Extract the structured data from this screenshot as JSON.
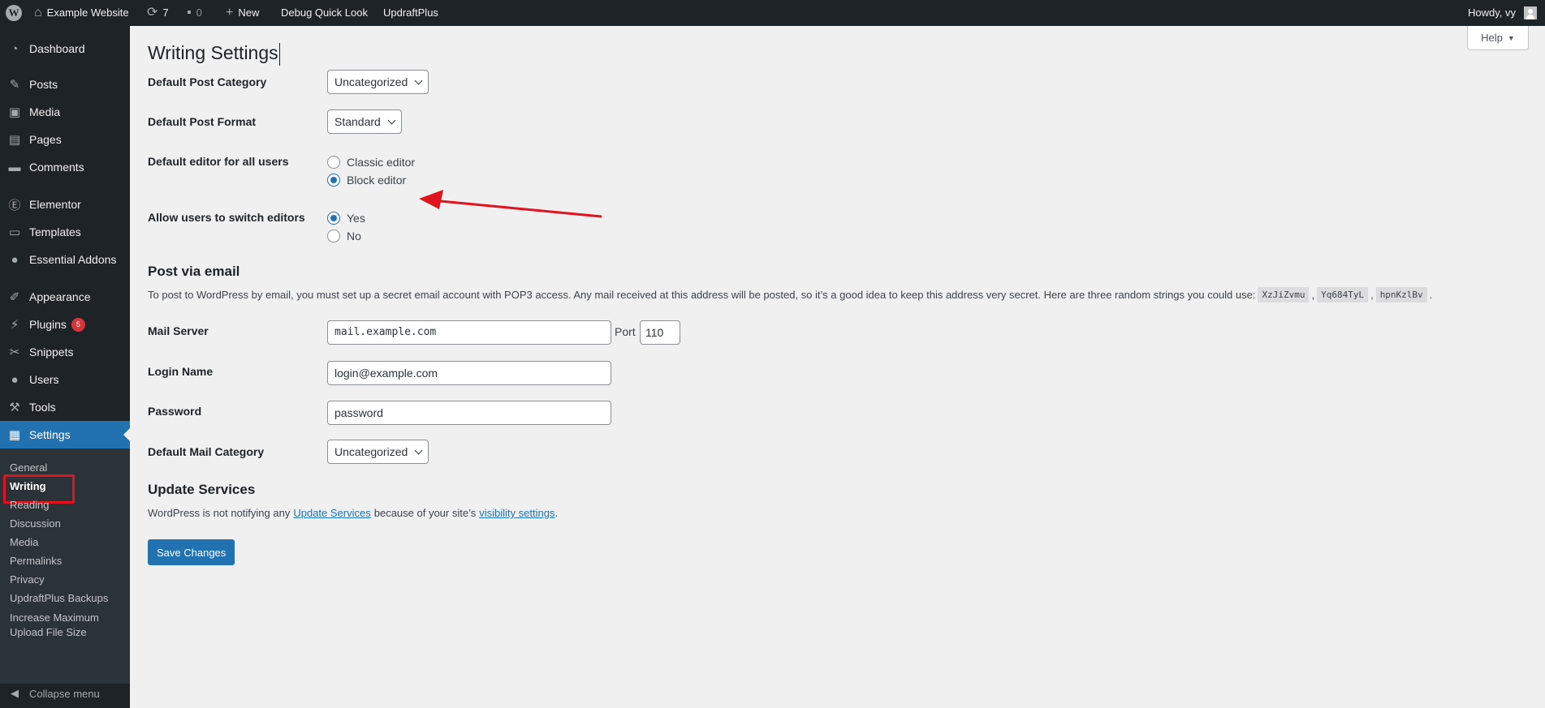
{
  "admin_bar": {
    "site_name": "Example Website",
    "updates_count": "7",
    "comments_count": "0",
    "new_label": "New",
    "debug_label": "Debug Quick Look",
    "updraft_label": "UpdraftPlus",
    "howdy": "Howdy, vy"
  },
  "sidebar": {
    "items": [
      {
        "label": "Dashboard",
        "icon": "dashboard-icon"
      },
      {
        "label": "Posts",
        "icon": "pin-icon"
      },
      {
        "label": "Media",
        "icon": "media-icon"
      },
      {
        "label": "Pages",
        "icon": "pages-icon"
      },
      {
        "label": "Comments",
        "icon": "comment-icon"
      },
      {
        "label": "Elementor",
        "icon": "elementor-icon"
      },
      {
        "label": "Templates",
        "icon": "folder-icon"
      },
      {
        "label": "Essential Addons",
        "icon": "ea-icon"
      },
      {
        "label": "Appearance",
        "icon": "brush-icon"
      },
      {
        "label": "Plugins",
        "icon": "plug-icon",
        "badge": "5"
      },
      {
        "label": "Snippets",
        "icon": "scissors-icon"
      },
      {
        "label": "Users",
        "icon": "user-icon"
      },
      {
        "label": "Tools",
        "icon": "wrench-icon"
      },
      {
        "label": "Settings",
        "icon": "settings-icon"
      }
    ],
    "submenu": [
      "General",
      "Writing",
      "Reading",
      "Discussion",
      "Media",
      "Permalinks",
      "Privacy",
      "UpdraftPlus Backups",
      "Increase Maximum",
      "Upload File Size"
    ],
    "collapse_label": "Collapse menu"
  },
  "help_label": "Help",
  "page_title": "Writing Settings",
  "fields": {
    "default_post_category_label": "Default Post Category",
    "default_post_category_value": "Uncategorized",
    "default_post_format_label": "Default Post Format",
    "default_post_format_value": "Standard",
    "default_editor_label": "Default editor for all users",
    "classic_editor": "Classic editor",
    "block_editor": "Block editor",
    "allow_switch_label": "Allow users to switch editors",
    "yes": "Yes",
    "no": "No"
  },
  "post_via_email": {
    "heading": "Post via email",
    "description": "To post to WordPress by email, you must set up a secret email account with POP3 access. Any mail received at this address will be posted, so it’s a good idea to keep this address very secret. Here are three random strings you could use:",
    "codes": [
      "XzJiZvmu",
      "Yq684TyL",
      "hpnKzlBv"
    ],
    "comma": ",",
    "period": ".",
    "mail_server_label": "Mail Server",
    "mail_server_value": "mail.example.com",
    "port_label": "Port",
    "port_value": "110",
    "login_name_label": "Login Name",
    "login_name_value": "login@example.com",
    "password_label": "Password",
    "password_value": "password",
    "default_mail_category_label": "Default Mail Category",
    "default_mail_category_value": "Uncategorized"
  },
  "update_services": {
    "heading": "Update Services",
    "text_before": "WordPress is not notifying any",
    "link1": "Update Services",
    "text_middle": "because of your site’s",
    "link2": "visibility settings",
    "text_after": "."
  },
  "save_button": "Save Changes",
  "colors": {
    "accent": "#2271b1",
    "sidebar_bg": "#1d2327",
    "annotation_red": "#e1131e"
  }
}
